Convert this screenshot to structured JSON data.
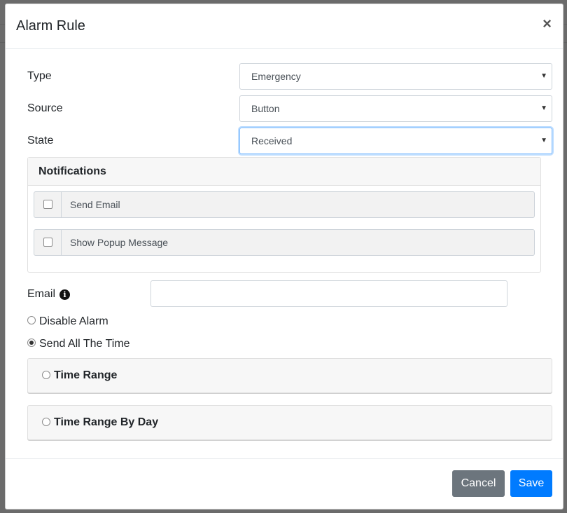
{
  "dialog": {
    "title": "Alarm Rule",
    "close_glyph": "×"
  },
  "form": {
    "type": {
      "label": "Type",
      "value": "Emergency"
    },
    "source": {
      "label": "Source",
      "value": "Button"
    },
    "state": {
      "label": "State",
      "value": "Received"
    }
  },
  "notifications": {
    "title": "Notifications",
    "items": [
      {
        "label": "Send Email",
        "checked": false
      },
      {
        "label": "Show Popup Message",
        "checked": false
      }
    ]
  },
  "email": {
    "label": "Email",
    "info_glyph": "i",
    "value": ""
  },
  "schedule": {
    "options": [
      {
        "label": "Disable Alarm",
        "checked": false
      },
      {
        "label": "Send All The Time",
        "checked": true
      }
    ],
    "panels": [
      {
        "label": "Time Range",
        "checked": false
      },
      {
        "label": "Time Range By Day",
        "checked": false
      }
    ]
  },
  "footer": {
    "cancel_label": "Cancel",
    "save_label": "Save"
  },
  "icons": {
    "caret": "caret-down-icon",
    "close": "close-icon",
    "info": "info-icon"
  },
  "colors": {
    "primary": "#007bff",
    "secondary": "#6c757d",
    "focus": "#80bdff"
  }
}
